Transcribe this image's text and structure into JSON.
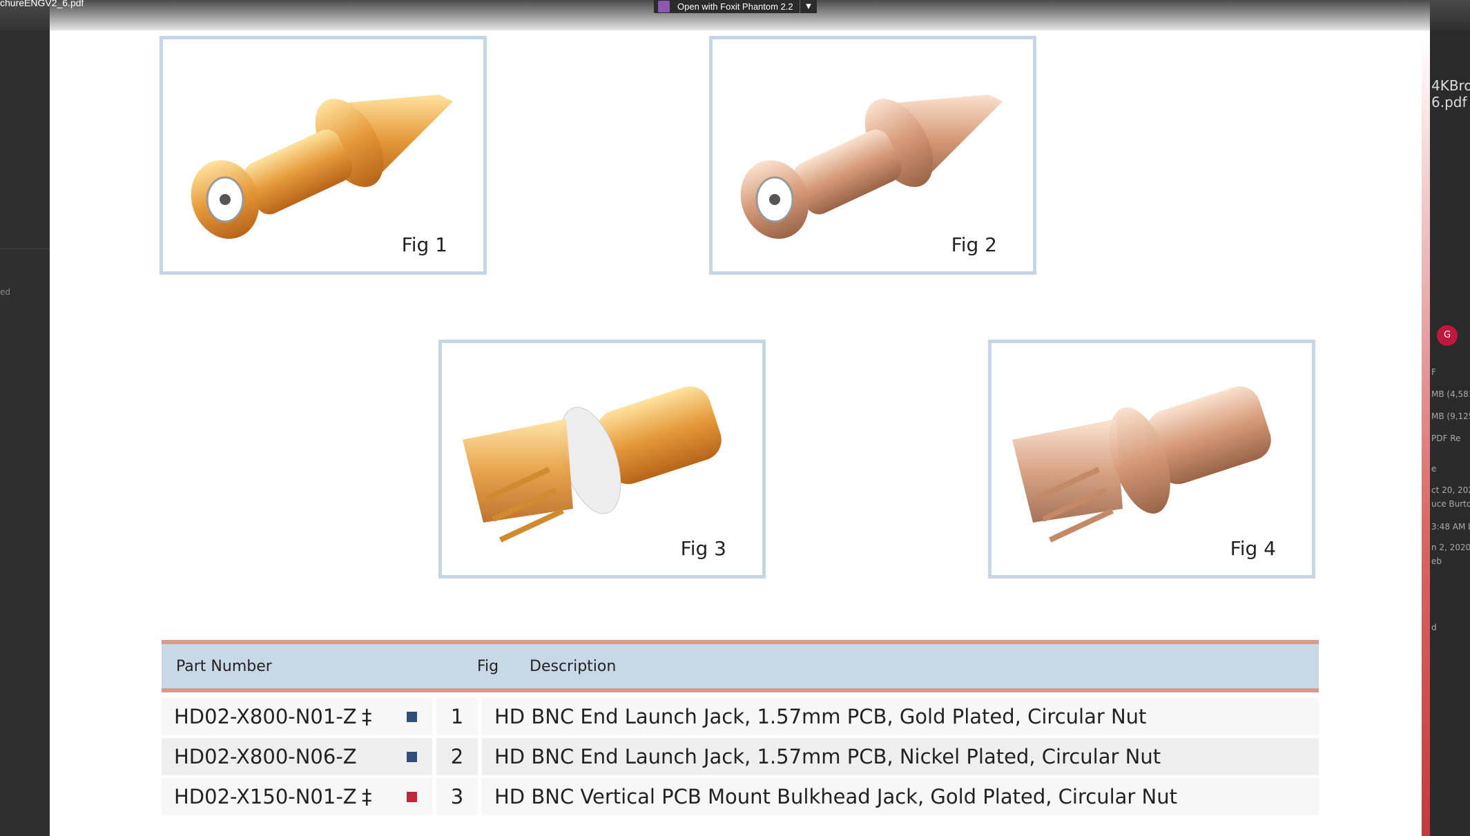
{
  "window": {
    "doc_title": "chureENGV2_6.pdf",
    "open_with_label": "Open with Foxit Phantom 2.2",
    "dropdown_icon": "chevron-down-icon"
  },
  "figures": [
    {
      "caption": "Fig 1",
      "finish": "gold"
    },
    {
      "caption": "Fig 2",
      "finish": "nickel"
    },
    {
      "caption": "Fig 3",
      "finish": "gold"
    },
    {
      "caption": "Fig 4",
      "finish": "nickel"
    }
  ],
  "table": {
    "headers": {
      "part": "Part Number",
      "fig": "Fig",
      "desc": "Description"
    },
    "rows": [
      {
        "part": "HD02-X800-N01-Z",
        "mark": "‡",
        "square_color": "#2f4f7a",
        "fig": "1",
        "desc": "HD BNC End Launch Jack, 1.57mm PCB, Gold Plated, Circular Nut"
      },
      {
        "part": "HD02-X800-N06-Z",
        "mark": "",
        "square_color": "#2f4f7a",
        "fig": "2",
        "desc": "HD BNC End Launch Jack, 1.57mm PCB, Nickel Plated, Circular Nut"
      },
      {
        "part": "HD02-X150-N01-Z",
        "mark": "‡",
        "square_color": "#c0283a",
        "fig": "3",
        "desc": "HD BNC Vertical PCB Mount Bulkhead Jack, Gold Plated, Circular Nut"
      }
    ]
  },
  "side_panel": {
    "file_title": "4KBro 6.pdf",
    "avatar_letter": "G",
    "lines": [
      "F",
      "MB (4,581",
      "MB (9,125",
      "PDF Re",
      "e",
      "ct 20, 202",
      "uce Burto",
      "3:48 AM b",
      "n 2, 2020",
      "eb",
      "d"
    ]
  },
  "left_panel": {
    "label": "ed"
  },
  "colors": {
    "frame": "#c7d6e6",
    "table_header": "#c9d8e6",
    "rule": "#d99a8c",
    "gold": "#e8a94a",
    "nickel": "#d8ab90"
  }
}
